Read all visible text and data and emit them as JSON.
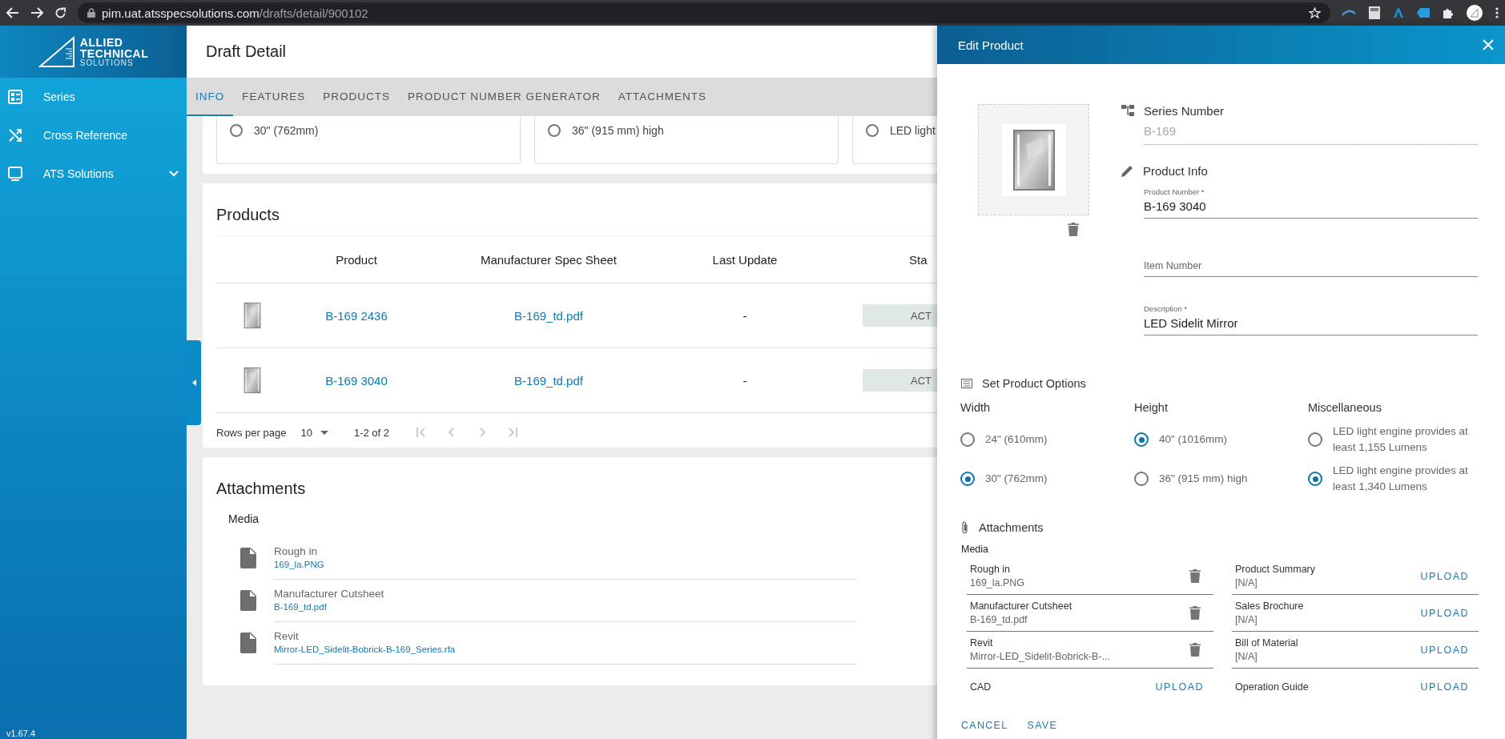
{
  "browser": {
    "url_host": "pim.uat.atsspecsolutions.com",
    "url_path": "/drafts/detail/900102"
  },
  "sidebar": {
    "logo": [
      "ALLIED",
      "TECHNICAL",
      "SOLUTIONS"
    ],
    "items": [
      {
        "label": "Series",
        "expandable": false
      },
      {
        "label": "Cross Reference",
        "expandable": false
      },
      {
        "label": "ATS Solutions",
        "expandable": true
      }
    ],
    "version": "v1.67.4"
  },
  "page": {
    "title": "Draft Detail",
    "tabs": [
      {
        "label": "INFO",
        "selected": true
      },
      {
        "label": "FEATURES",
        "selected": false
      },
      {
        "label": "PRODUCTS",
        "selected": false
      },
      {
        "label": "PRODUCT NUMBER GENERATOR",
        "selected": false
      },
      {
        "label": "ATTACHMENTS",
        "selected": false
      }
    ],
    "option_cards": [
      {
        "label": "30\" (762mm)",
        "selected": false
      },
      {
        "label": "36\" (915 mm) high",
        "selected": false
      },
      {
        "label": "LED light",
        "selected": false
      }
    ],
    "products": {
      "title": "Products",
      "columns": [
        "Product",
        "Manufacturer Spec Sheet",
        "Last Update",
        "Sta"
      ],
      "rows": [
        {
          "product": "B-169 2436",
          "spec_sheet": "B-169_td.pdf",
          "last_update": "-",
          "status": "ACT"
        },
        {
          "product": "B-169 3040",
          "spec_sheet": "B-169_td.pdf",
          "last_update": "-",
          "status": "ACT"
        }
      ],
      "pagination": {
        "label": "Rows per page",
        "rows_per_page": "10",
        "range": "1-2 of 2"
      }
    },
    "attachments": {
      "title": "Attachments",
      "group": "Media",
      "items": [
        {
          "label": "Rough in",
          "file": "169_la.PNG"
        },
        {
          "label": "Manufacturer Cutsheet",
          "file": "B-169_td.pdf"
        },
        {
          "label": "Revit",
          "file": "Mirror-LED_Sidelit-Bobrick-B-169_Series.rfa"
        }
      ]
    }
  },
  "edit_panel": {
    "title": "Edit Product",
    "series_number": {
      "label": "Series Number",
      "value": "B-169"
    },
    "product_info": {
      "heading": "Product Info",
      "fields": [
        {
          "label": "Product Number *",
          "value": "B-169 3040"
        },
        {
          "placeholder": "Item Number"
        },
        {
          "label": "Description *",
          "value": "LED Sidelit Mirror"
        }
      ]
    },
    "options": {
      "heading": "Set Product Options",
      "groups": [
        {
          "name": "Width",
          "options": [
            {
              "label": "24\" (610mm)",
              "selected": false
            },
            {
              "label": "30\" (762mm)",
              "selected": true
            }
          ]
        },
        {
          "name": "Height",
          "options": [
            {
              "label": "40\" (1016mm)",
              "selected": true
            },
            {
              "label": "36\" (915 mm) high",
              "selected": false
            }
          ]
        },
        {
          "name": "Miscellaneous",
          "options": [
            {
              "label": "LED light engine provides at least 1,155 Lumens",
              "selected": false
            },
            {
              "label": "LED light engine provides at least 1,340 Lumens",
              "selected": true
            }
          ]
        }
      ]
    },
    "attachments": {
      "heading": "Attachments",
      "group": "Media",
      "columns": [
        [
          {
            "label": "Rough in",
            "file": "169_la.PNG",
            "kind": "file"
          },
          {
            "label": "Manufacturer Cutsheet",
            "file": "B-169_td.pdf",
            "kind": "file"
          },
          {
            "label": "Revit",
            "file": "Mirror-LED_Sidelit-Bobrick-B-...",
            "kind": "file"
          },
          {
            "label": "CAD",
            "kind": "upload",
            "action": "UPLOAD"
          }
        ],
        [
          {
            "label": "Product Summary",
            "file": "[N/A]",
            "kind": "upload",
            "action": "UPLOAD"
          },
          {
            "label": "Sales Brochure",
            "file": "[N/A]",
            "kind": "upload",
            "action": "UPLOAD"
          },
          {
            "label": "Bill of Material",
            "file": "[N/A]",
            "kind": "upload",
            "action": "UPLOAD"
          },
          {
            "label": "Operation Guide",
            "kind": "upload",
            "action": "UPLOAD"
          }
        ]
      ]
    },
    "buttons": [
      "CANCEL",
      "SAVE"
    ]
  }
}
